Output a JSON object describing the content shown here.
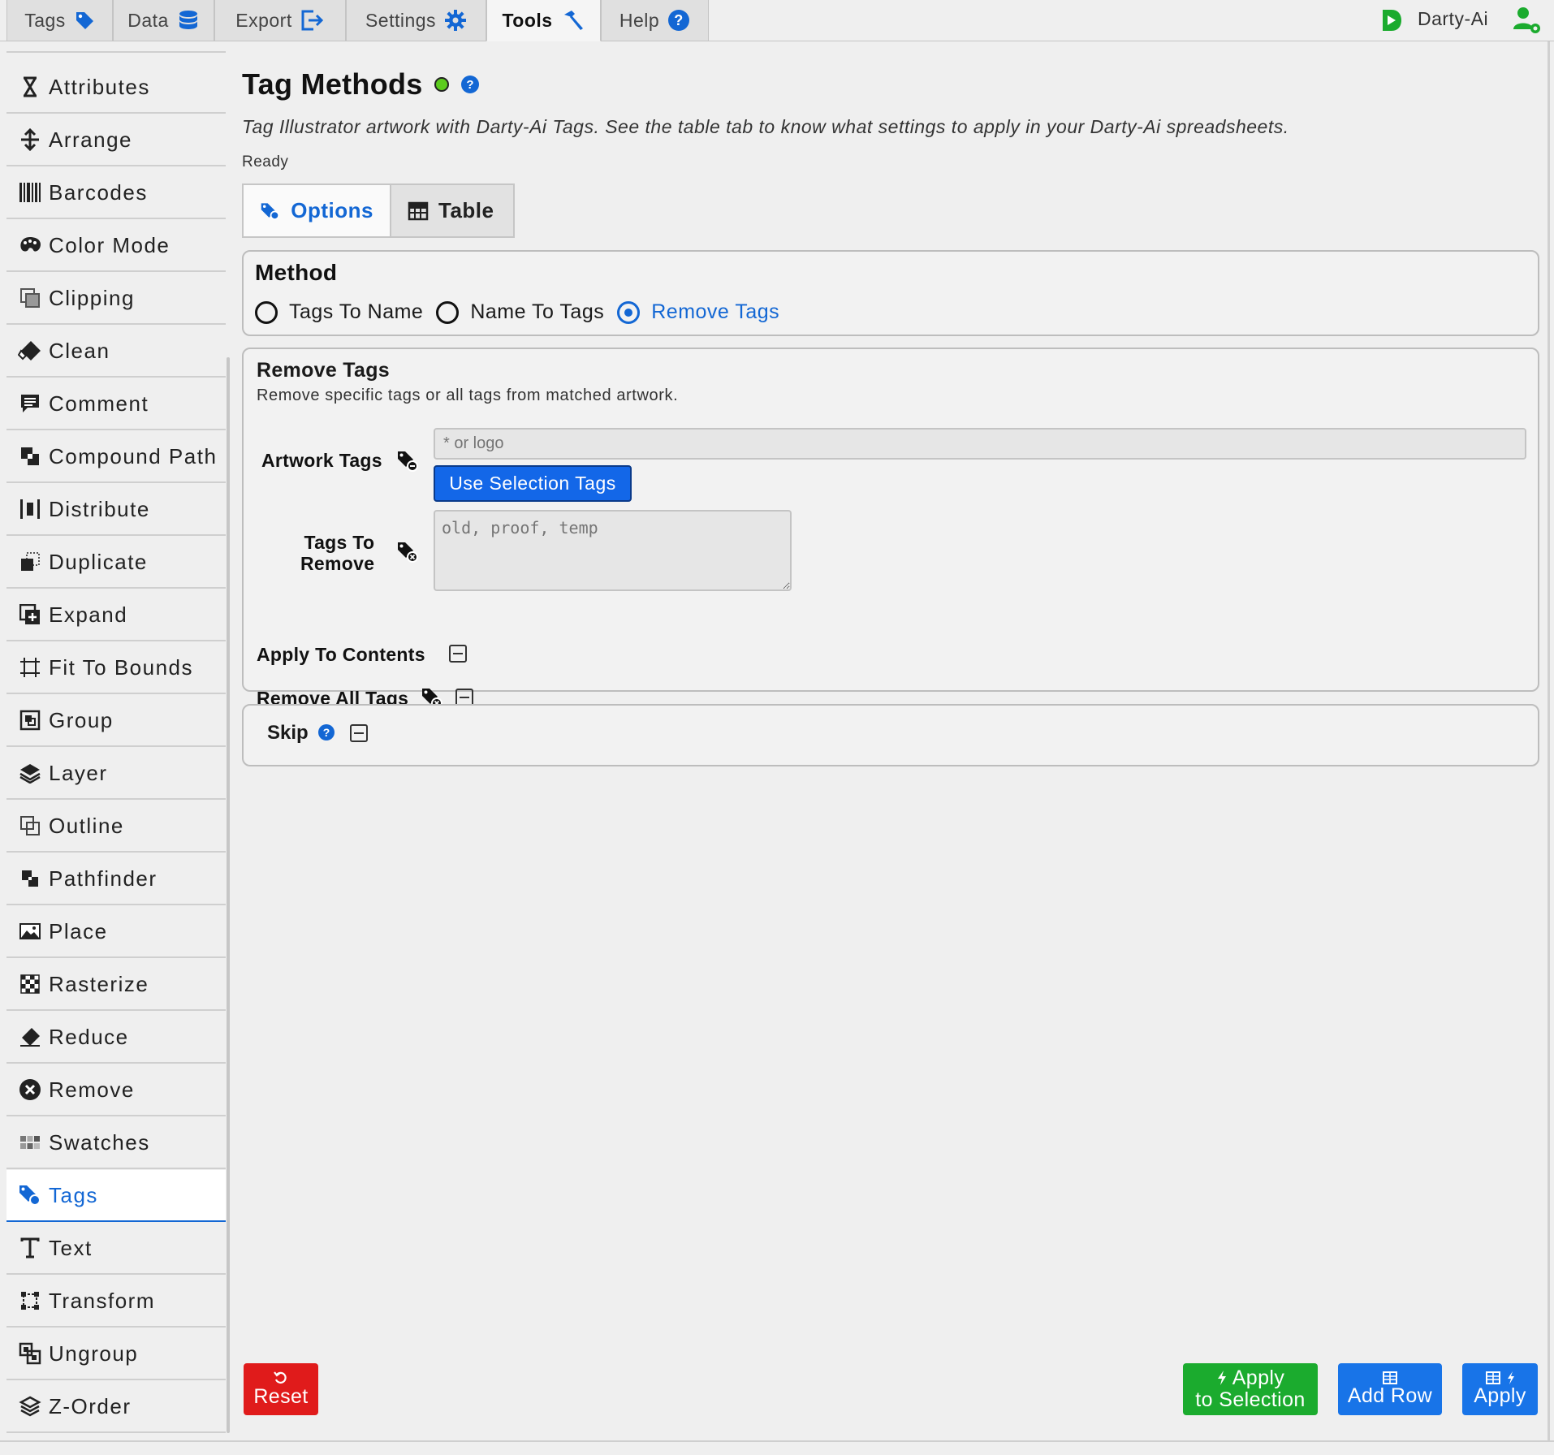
{
  "topbar": {
    "tabs": [
      {
        "label": "Tags",
        "icon": "tag-icon"
      },
      {
        "label": "Data",
        "icon": "database-icon"
      },
      {
        "label": "Export",
        "icon": "export-icon"
      },
      {
        "label": "Settings",
        "icon": "gear-icon"
      },
      {
        "label": "Tools",
        "icon": "hammer-icon",
        "active": true
      },
      {
        "label": "Help",
        "icon": "help-icon"
      }
    ],
    "brand": "Darty-Ai"
  },
  "sidebar": {
    "items": [
      {
        "label": "Attributes",
        "icon": "attributes-icon"
      },
      {
        "label": "Arrange",
        "icon": "arrange-icon"
      },
      {
        "label": "Barcodes",
        "icon": "barcode-icon"
      },
      {
        "label": "Color Mode",
        "icon": "palette-icon"
      },
      {
        "label": "Clipping",
        "icon": "clipping-icon"
      },
      {
        "label": "Clean",
        "icon": "eraser-icon"
      },
      {
        "label": "Comment",
        "icon": "comment-icon"
      },
      {
        "label": "Compound Path",
        "icon": "compound-path-icon"
      },
      {
        "label": "Distribute",
        "icon": "distribute-icon"
      },
      {
        "label": "Duplicate",
        "icon": "duplicate-icon"
      },
      {
        "label": "Expand",
        "icon": "expand-icon"
      },
      {
        "label": "Fit To Bounds",
        "icon": "fit-bounds-icon"
      },
      {
        "label": "Group",
        "icon": "group-icon"
      },
      {
        "label": "Layer",
        "icon": "layer-icon"
      },
      {
        "label": "Outline",
        "icon": "outline-icon"
      },
      {
        "label": "Pathfinder",
        "icon": "pathfinder-icon"
      },
      {
        "label": "Place",
        "icon": "image-icon"
      },
      {
        "label": "Rasterize",
        "icon": "rasterize-icon"
      },
      {
        "label": "Reduce",
        "icon": "reduce-icon"
      },
      {
        "label": "Remove",
        "icon": "remove-icon"
      },
      {
        "label": "Swatches",
        "icon": "swatches-icon"
      },
      {
        "label": "Tags",
        "icon": "tags-icon",
        "active": true
      },
      {
        "label": "Text",
        "icon": "text-icon"
      },
      {
        "label": "Transform",
        "icon": "transform-icon"
      },
      {
        "label": "Ungroup",
        "icon": "ungroup-icon"
      },
      {
        "label": "Z-Order",
        "icon": "z-order-icon"
      }
    ]
  },
  "main": {
    "title": "Tag Methods",
    "description": "Tag Illustrator artwork with Darty-Ai Tags. See the table tab to know what settings to apply in your Darty-Ai spreadsheets.",
    "status": "Ready",
    "subtabs": [
      {
        "label": "Options",
        "active": true
      },
      {
        "label": "Table"
      }
    ],
    "method": {
      "title": "Method",
      "options": [
        "Tags To Name",
        "Name To Tags",
        "Remove Tags"
      ],
      "selected": "Remove Tags"
    },
    "remove_tags": {
      "title": "Remove Tags",
      "description": "Remove specific tags or all tags from matched artwork.",
      "artwork_tags_label": "Artwork Tags",
      "artwork_tags_placeholder": "* or logo",
      "artwork_tags_value": "",
      "use_selection_label": "Use Selection Tags",
      "tags_to_remove_label_1": "Tags To",
      "tags_to_remove_label_2": "Remove",
      "tags_to_remove_placeholder": "old, proof, temp",
      "apply_to_contents_label": "Apply To Contents",
      "remove_all_tags_label": "Remove All Tags"
    },
    "skip": {
      "label": "Skip"
    }
  },
  "footer": {
    "reset_label": "Reset",
    "apply_selection_line1": "Apply",
    "apply_selection_line2": "to Selection",
    "add_row_label": "Add Row",
    "apply_label": "Apply"
  },
  "colors": {
    "accent_blue": "#1367d4",
    "button_blue": "#1874e8",
    "reset_red": "#e01b1b",
    "apply_green": "#1bab2e",
    "status_green": "#5ccc1e"
  }
}
